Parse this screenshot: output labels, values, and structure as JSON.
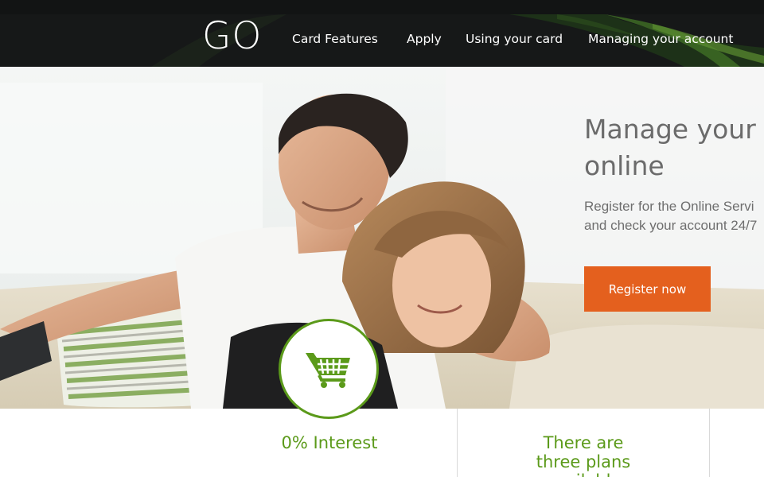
{
  "header": {
    "logo": "GO",
    "nav": [
      {
        "label": "Card Features"
      },
      {
        "label": "Apply"
      },
      {
        "label": "Using your card"
      },
      {
        "label": "Managing your account"
      }
    ]
  },
  "hero": {
    "title_line1": "Manage your",
    "title_line2": "online",
    "text_line1": "Register for the Online Servi",
    "text_line2": "and check your account 24/7",
    "button_label": "Register now"
  },
  "features": [
    {
      "title": "0% Interest",
      "icon": "shopping-cart-icon"
    },
    {
      "title": "There are three plans available"
    }
  ],
  "colors": {
    "header_bg": "#161818",
    "accent_green": "#5b9a1a",
    "button_orange": "#e4601e",
    "text_gray": "#6b6b6b"
  }
}
